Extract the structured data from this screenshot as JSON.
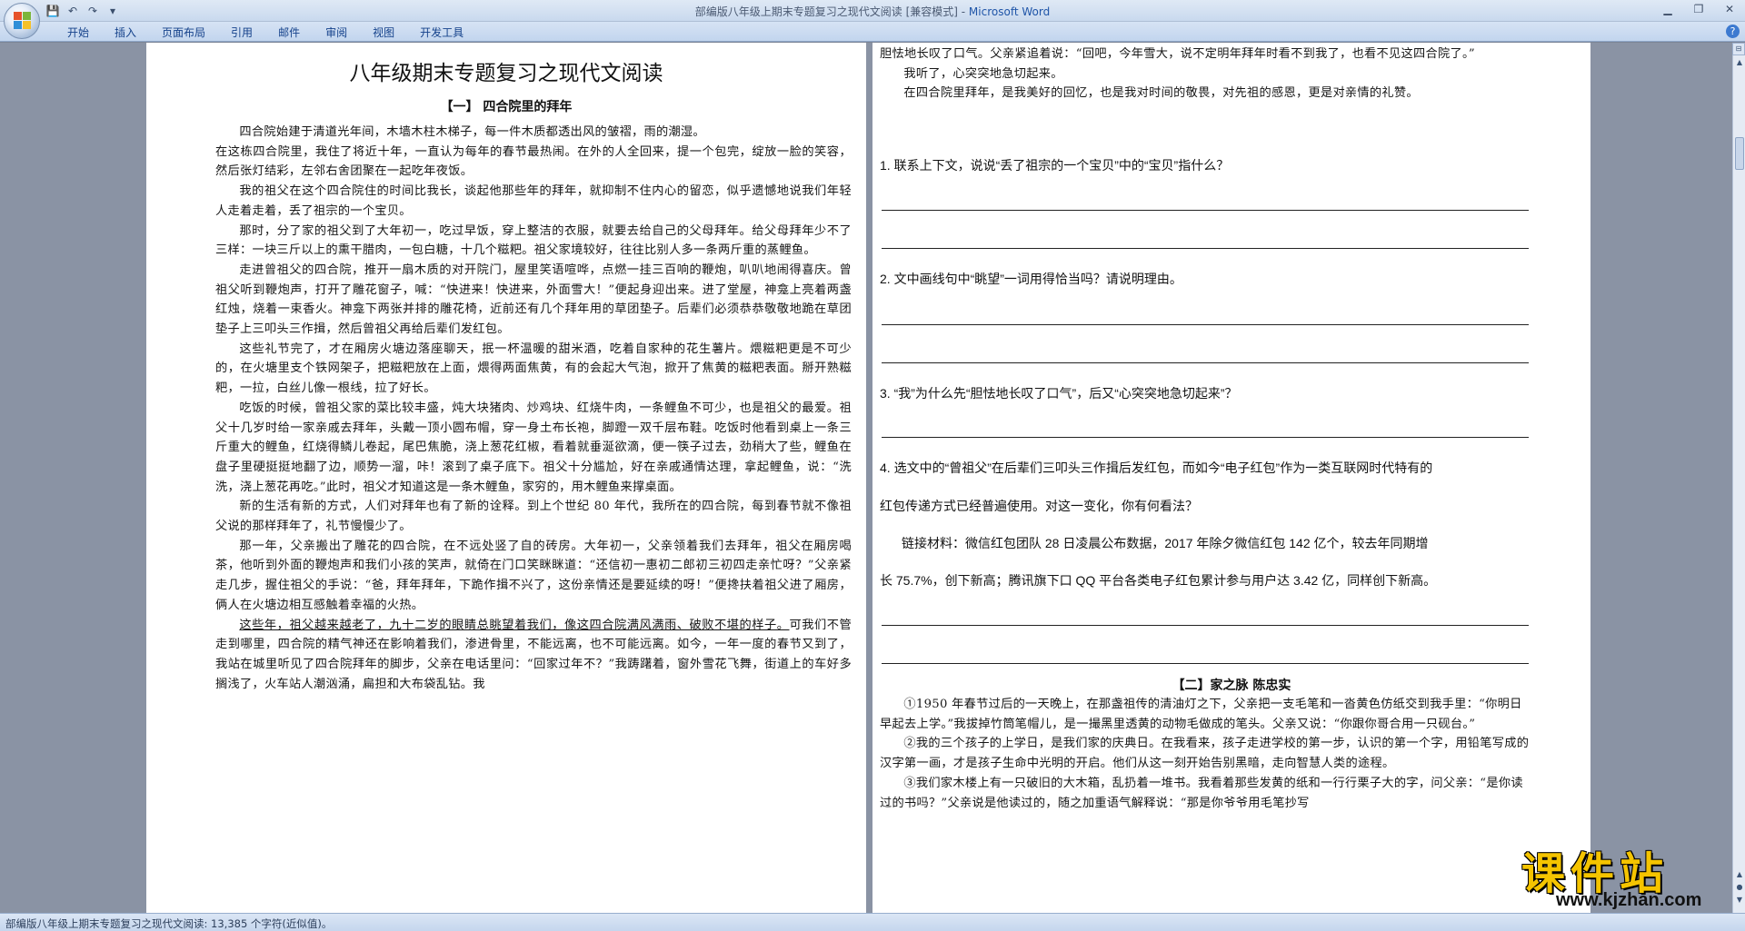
{
  "window": {
    "title_doc": "部编版八年级上期末专题复习之现代文阅读 [兼容模式] - ",
    "title_app": "Microsoft Word"
  },
  "ribbon": {
    "tabs": [
      "开始",
      "插入",
      "页面布局",
      "引用",
      "邮件",
      "审阅",
      "视图",
      "开发工具"
    ]
  },
  "document": {
    "title": "八年级期末专题复习之现代文阅读",
    "section1_heading": "【一】 四合院里的拜年",
    "left_paragraphs": [
      {
        "indent": true,
        "text": "四合院始建于清道光年间，木墙木柱木梯子，每一件木质都透出风的皱褶，雨的潮湿。"
      },
      {
        "indent": false,
        "text": "在这栋四合院里，我住了将近十年，一直认为每年的春节最热闹。在外的人全回来，提一个包完，绽放一脸的笑容，然后张灯结彩，左邻右舍团聚在一起吃年夜饭。"
      },
      {
        "indent": true,
        "text": "我的祖父在这个四合院住的时间比我长，谈起他那些年的拜年，就抑制不住内心的留恋，似乎遗憾地说我们年轻人走着走着，丢了祖宗的一个宝贝。"
      },
      {
        "indent": true,
        "text": "那时，分了家的祖父到了大年初一，吃过早饭，穿上整洁的衣服，就要去给自己的父母拜年。给父母拜年少不了三样：一块三斤以上的熏干腊肉，一包白糖，十几个糍粑。祖父家境较好，往往比别人多一条两斤重的蒸鲤鱼。"
      },
      {
        "indent": true,
        "text": "走进曾祖父的四合院，推开一扇木质的对开院门，屋里笑语喧哗，点燃一挂三百响的鞭炮，叭叭地闹得喜庆。曾祖父听到鞭炮声，打开了雕花窗子，喊：“快进来！快进来，外面雪大！”便起身迎出来。进了堂屋，神龛上亮着两盏红烛，烧着一束香火。神龛下两张并排的雕花椅，近前还有几个拜年用的草团垫子。后辈们必须恭恭敬敬地跪在草团垫子上三叩头三作揖，然后曾祖父再给后辈们发红包。"
      },
      {
        "indent": true,
        "text": "这些礼节完了，才在厢房火塘边落座聊天，抿一杯温暖的甜米酒，吃着自家种的花生薯片。煨糍粑更是不可少的，在火塘里支个铁网架子，把糍粑放在上面，煨得两面焦黄，有的会起大气泡，掀开了焦黄的糍粑表面。掰开熟糍粑，一拉，白丝儿像一根线，拉了好长。"
      },
      {
        "indent": true,
        "text": "吃饭的时候，曾祖父家的菜比较丰盛，炖大块猪肉、炒鸡块、红烧牛肉，一条鲤鱼不可少，也是祖父的最爱。祖父十几岁时给一家亲戚去拜年，头戴一顶小圆布帽，穿一身土布长袍，脚蹬一双千层布鞋。吃饭时他看到桌上一条三斤重大的鲤鱼，红烧得鳞儿卷起，尾巴焦脆，浇上葱花红椒，看着就垂涎欲滴，便一筷子过去，劲稍大了些，鲤鱼在盘子里硬挺挺地翻了边，顺势一溜，咔！滚到了桌子底下。祖父十分尴尬，好在亲戚通情达理，拿起鲤鱼，说：“洗洗，浇上葱花再吃。”此时，祖父才知道这是一条木鲤鱼，家穷的，用木鲤鱼来撑桌面。"
      },
      {
        "indent": true,
        "text": "新的生活有新的方式，人们对拜年也有了新的诠释。到上个世纪 80 年代，我所在的四合院，每到春节就不像祖父说的那样拜年了，礼节慢慢少了。"
      },
      {
        "indent": true,
        "text": "那一年，父亲搬出了雕花的四合院，在不远处竖了自的砖房。大年初一，父亲领着我们去拜年，祖父在厢房喝茶，他听到外面的鞭炮声和我们小孩的笑声，就倚在门口笑眯眯道：“还信初一惠初二郎初三初四走亲忙呀？”父亲紧走几步，握住祖父的手说：“爸，拜年拜年，下跪作揖不兴了，这份亲情还是要延续的呀！”便搀扶着祖父进了厢房，俩人在火塘边相互感触着幸福的火热。"
      },
      {
        "indent": true,
        "underline": "这些年，祖父越来越老了，九十二岁的眼睛总眺望着我们，像这四合院满风满雨、破败不堪的样子。",
        "text": "可我们不管走到哪里，四合院的精气神还在影响着我们，渗进骨里，不能远离，也不可能远离。如今，一年一度的春节又到了，我站在城里听见了四合院拜年的脚步，父亲在电话里问：“回家过年不？”我踌躇着，窗外雪花飞舞，街道上的车好多搁浅了，火车站人潮汹涌，扁担和大布袋乱钻。我"
      }
    ],
    "right_paragraphs": [
      {
        "indent": false,
        "text": "胆怯地长叹了口气。父亲紧追着说：“回吧，今年雪大，说不定明年拜年时看不到我了，也看不见这四合院了。”"
      },
      {
        "indent": true,
        "text": "我听了，心突突地急切起来。"
      },
      {
        "indent": true,
        "text": "在四合院里拜年，是我美好的回忆，也是我对时间的敬畏，对先祖的感恩，更是对亲情的礼赞。"
      }
    ],
    "questions": {
      "q1": "1.   联系上下文，说说“丢了祖宗的一个宝贝”中的“宝贝”指什么？",
      "q2": "2.   文中画线句中“眺望”一词用得恰当吗？请说明理由。",
      "q3": "3.   “我”为什么先“胆怯地长叹了口气”，后又“心突突地急切起来”？",
      "q4_line1": "4. 选文中的“曾祖父”在后辈们三叩头三作揖后发红包，而如今“电子红包”作为一类互联网时代特有的",
      "q4_line2": "红包传递方式已经普遍使用。对这一变化，你有何看法？",
      "link_line1": "链接材料：微信红包团队 28  日凌晨公布数据，2017  年除夕微信红包 142  亿个，较去年同期增",
      "link_line2": "长 75.7%，创下新高；腾讯旗下口 QQ 平台各类电子红包累计参与用户达 3.42  亿，同样创下新高。"
    },
    "section2_heading": "【二】家之脉    陈忠实",
    "section2_paragraphs": [
      {
        "text": "①1950 年春节过后的一天晚上，在那盏祖传的清油灯之下，父亲把一支毛笔和一沓黄色仿纸交到我手里：“你明日早起去上学。”我拔掉竹筒笔帽儿，是一撮黑里透黄的动物毛做成的笔头。父亲又说：“你跟你哥合用一只砚台。”"
      },
      {
        "text": "②我的三个孩子的上学日，是我们家的庆典日。在我看来，孩子走进学校的第一步，认识的第一个字，用铅笔写成的汉字第一画，才是孩子生命中光明的开启。他们从这一刻开始告别黑暗，走向智慧人类的途程。"
      },
      {
        "text": "③我们家木楼上有一只破旧的大木箱，乱扔着一堆书。我看着那些发黄的纸和一行行栗子大的字，问父亲：“是你读过的书吗？”父亲说是他读过的，随之加重语气解释说：“那是你爷爷用毛笔抄写"
      }
    ]
  },
  "status": {
    "text": "部编版八年级上期末专题复习之现代文阅读: 13,385 个字符(近似值)。"
  },
  "watermark": {
    "main": "课件站",
    "url": "www.kjzhan.com"
  },
  "colors": {
    "page_bg": "#ffffff",
    "workspace_bg": "#8a93a4",
    "ribbon_tab_text": "#15428b",
    "watermark_yellow": "#f5c400"
  }
}
